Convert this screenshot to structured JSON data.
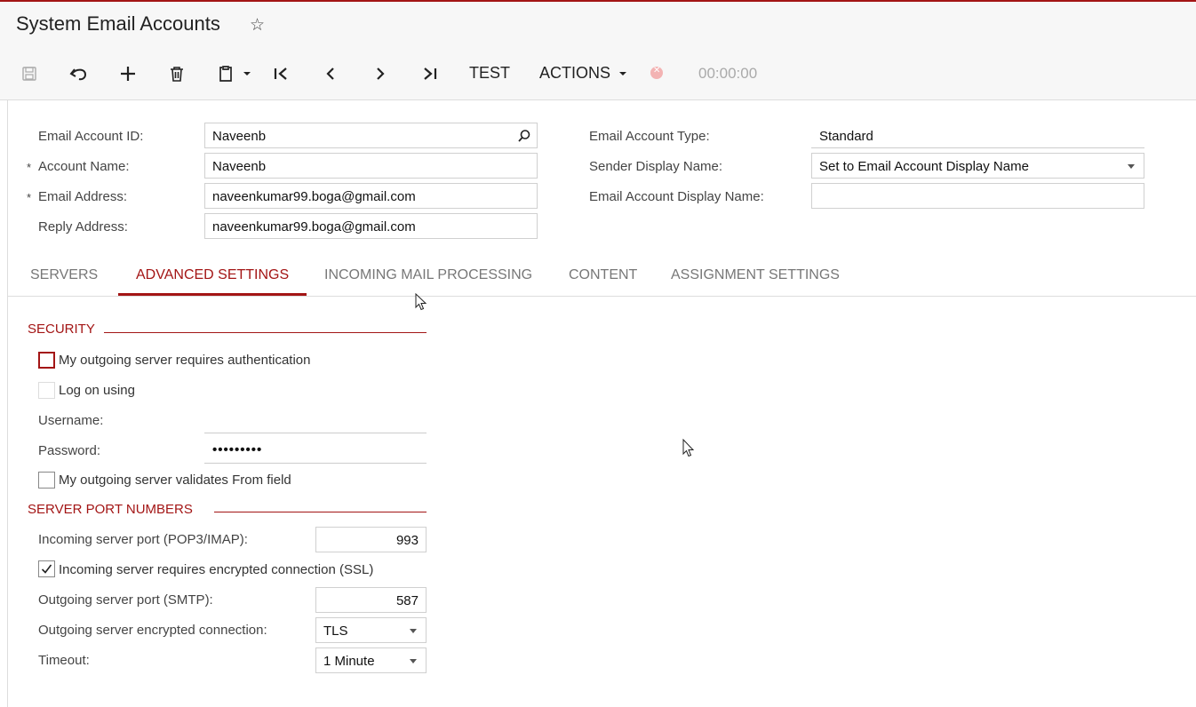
{
  "page": {
    "title": "System Email Accounts",
    "star_glyph": "☆"
  },
  "toolbar": {
    "test_label": "TEST",
    "actions_label": "ACTIONS",
    "timer": "00:00:00"
  },
  "form": {
    "email_account_id": {
      "label": "Email Account ID:",
      "value": "Naveenb"
    },
    "account_name": {
      "label": "Account Name:",
      "value": "Naveenb",
      "required_mark": "*"
    },
    "email_address": {
      "label": "Email Address:",
      "value": "naveenkumar99.boga@gmail.com",
      "required_mark": "*"
    },
    "reply_address": {
      "label": "Reply Address:",
      "value": "naveenkumar99.boga@gmail.com"
    },
    "email_account_type": {
      "label": "Email Account Type:",
      "value": "Standard"
    },
    "sender_display_name": {
      "label": "Sender Display Name:",
      "value": "Set to Email Account Display Name"
    },
    "email_account_display_name": {
      "label": "Email Account Display Name:",
      "value": ""
    }
  },
  "tabs": [
    {
      "label": "SERVERS",
      "active": false
    },
    {
      "label": "ADVANCED SETTINGS",
      "active": true
    },
    {
      "label": "INCOMING MAIL PROCESSING",
      "active": false
    },
    {
      "label": "CONTENT",
      "active": false
    },
    {
      "label": "ASSIGNMENT SETTINGS",
      "active": false
    }
  ],
  "security": {
    "title": "SECURITY",
    "requires_auth": {
      "label": "My outgoing server requires authentication",
      "checked": false
    },
    "log_on_using": {
      "label": "Log on using",
      "checked": false
    },
    "username": {
      "label": "Username:",
      "value": ""
    },
    "password": {
      "label": "Password:",
      "value": "•••••••••"
    },
    "validates_from": {
      "label": "My outgoing server validates From field",
      "checked": false
    }
  },
  "ports": {
    "title": "SERVER PORT NUMBERS",
    "incoming_port": {
      "label": "Incoming server port (POP3/IMAP):",
      "value": "993"
    },
    "incoming_ssl": {
      "label": "Incoming server requires encrypted connection (SSL)",
      "checked": true
    },
    "outgoing_port": {
      "label": "Outgoing server port (SMTP):",
      "value": "587"
    },
    "outgoing_encryption": {
      "label": "Outgoing server encrypted connection:",
      "value": "TLS"
    },
    "timeout": {
      "label": "Timeout:",
      "value": "1 Minute"
    }
  },
  "colors": {
    "accent": "#a31515"
  }
}
